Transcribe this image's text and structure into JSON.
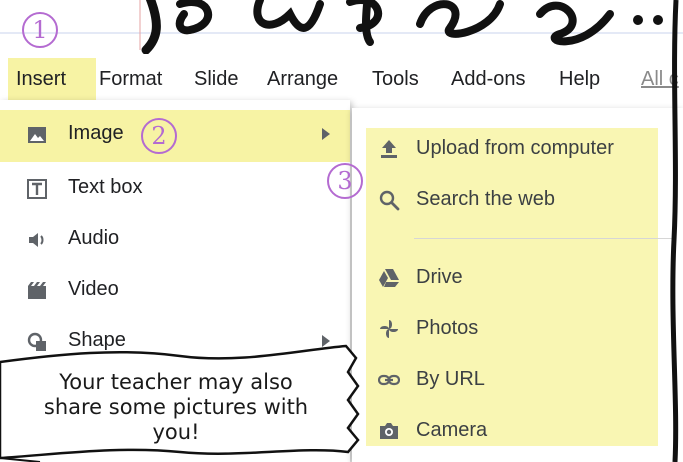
{
  "steps": {
    "one": "1",
    "two": "2",
    "three": "3"
  },
  "menubar": {
    "items": [
      "Insert",
      "Format",
      "Slide",
      "Arrange",
      "Tools",
      "Add-ons",
      "Help"
    ],
    "all_changes": "All c"
  },
  "insert_menu": {
    "items": [
      {
        "label": "Image",
        "icon": "image-icon"
      },
      {
        "label": "Text box",
        "icon": "text-box-icon"
      },
      {
        "label": "Audio",
        "icon": "audio-icon"
      },
      {
        "label": "Video",
        "icon": "video-icon"
      },
      {
        "label": "Shape",
        "icon": "shape-icon"
      }
    ]
  },
  "image_submenu": {
    "items": [
      {
        "label": "Upload from computer",
        "icon": "upload-icon"
      },
      {
        "label": "Search the web",
        "icon": "search-icon"
      },
      {
        "label": "Drive",
        "icon": "drive-icon"
      },
      {
        "label": "Photos",
        "icon": "photos-icon"
      },
      {
        "label": "By URL",
        "icon": "link-icon"
      },
      {
        "label": "Camera",
        "icon": "camera-icon"
      }
    ]
  },
  "caption": {
    "line1": "Your teacher may also",
    "line2": "share some pictures with",
    "line3": "you!"
  },
  "colors": {
    "highlight": "#f7f3a4",
    "step_badge": "#b46bd1",
    "text": "#202124",
    "icon": "#5f6368"
  }
}
